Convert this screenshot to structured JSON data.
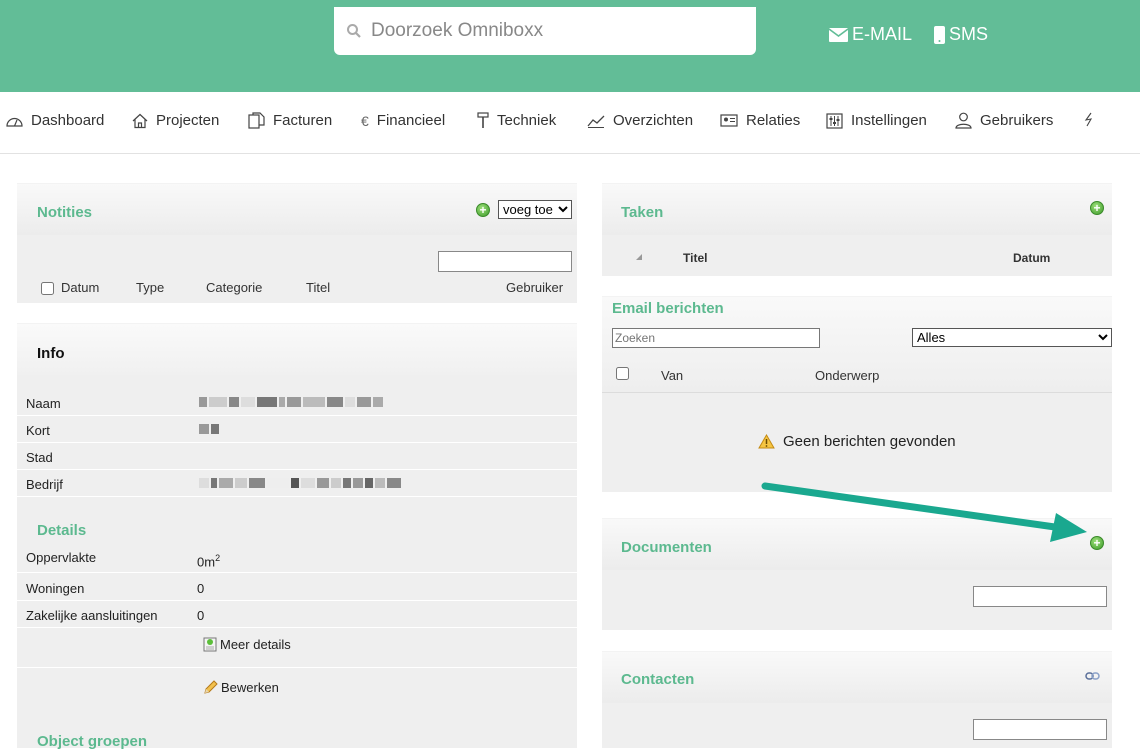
{
  "header": {
    "search_placeholder": "Doorzoek Omniboxx",
    "email_label": "E-MAIL",
    "sms_label": "SMS"
  },
  "nav": {
    "items": [
      {
        "label": "Dashboard",
        "icon": "dashboard-icon"
      },
      {
        "label": "Projecten",
        "icon": "home-icon"
      },
      {
        "label": "Facturen",
        "icon": "documents-icon"
      },
      {
        "label": "Financieel",
        "icon": "euro-icon"
      },
      {
        "label": "Techniek",
        "icon": "hammer-icon"
      },
      {
        "label": "Overzichten",
        "icon": "chart-icon"
      },
      {
        "label": "Relaties",
        "icon": "contact-card-icon"
      },
      {
        "label": "Instellingen",
        "icon": "sliders-icon"
      },
      {
        "label": "Gebruikers",
        "icon": "user-icon"
      }
    ],
    "extra_icon": "lightning-icon"
  },
  "notities": {
    "title": "Notities",
    "add_select_value": "voeg toe",
    "columns": [
      "Datum",
      "Type",
      "Categorie",
      "Titel",
      "Gebruiker"
    ]
  },
  "info": {
    "title": "Info",
    "rows": [
      {
        "label": "Naam",
        "value": ""
      },
      {
        "label": "Kort",
        "value": ""
      },
      {
        "label": "Stad",
        "value": ""
      },
      {
        "label": "Bedrijf",
        "value": ""
      }
    ],
    "details_title": "Details",
    "details": [
      {
        "label": "Oppervlakte",
        "value": "0m",
        "sup": "2"
      },
      {
        "label": "Woningen",
        "value": "0"
      },
      {
        "label": "Zakelijke aansluitingen",
        "value": "0"
      }
    ],
    "more_details_label": "Meer details",
    "edit_label": "Bewerken",
    "object_groups_title": "Object groepen"
  },
  "taken": {
    "title": "Taken",
    "columns": [
      "Titel",
      "Datum"
    ]
  },
  "email": {
    "title": "Email berichten",
    "search_placeholder": "Zoeken",
    "filter_value": "Alles",
    "columns": [
      "Van",
      "Onderwerp"
    ],
    "empty_message": "Geen berichten gevonden"
  },
  "documenten": {
    "title": "Documenten"
  },
  "contacten": {
    "title": "Contacten"
  },
  "colors": {
    "accent": "#62bd97",
    "title_green": "#5cb98f",
    "arrow": "#1aa88f"
  }
}
